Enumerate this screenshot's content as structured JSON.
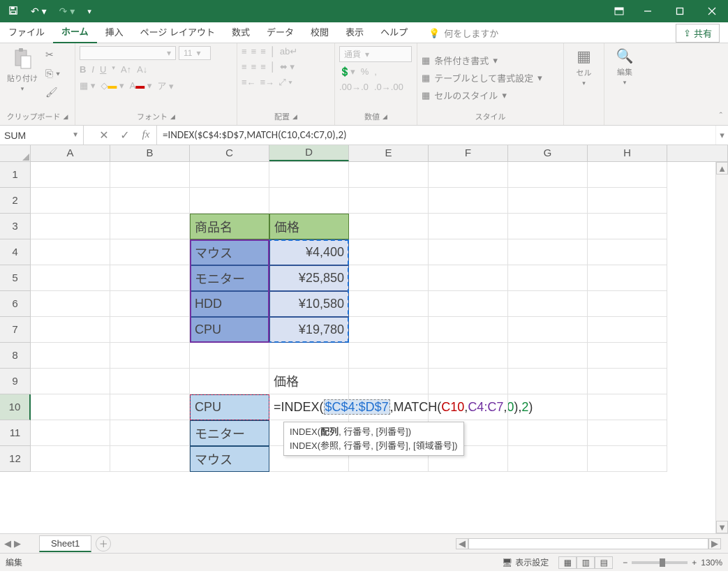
{
  "titlebar": {
    "qat": [
      "save",
      "undo",
      "redo"
    ]
  },
  "tabs": {
    "file": "ファイル",
    "home": "ホーム",
    "insert": "挿入",
    "pagelayout": "ページ レイアウト",
    "formulas": "数式",
    "data": "データ",
    "review": "校閲",
    "view": "表示",
    "help": "ヘルプ"
  },
  "tellme_placeholder": "何をしますか",
  "share": "共有",
  "ribbon": {
    "clipboard": {
      "paste": "貼り付け",
      "label": "クリップボード"
    },
    "font": {
      "label": "フォント",
      "size": "11"
    },
    "align": {
      "label": "配置"
    },
    "number": {
      "format": "通貨",
      "label": "数値"
    },
    "styles": {
      "cond": "条件付き書式",
      "table": "テーブルとして書式設定",
      "cell": "セルのスタイル",
      "label": "スタイル"
    },
    "cells": {
      "label": "セル"
    },
    "editing": {
      "label": "編集"
    }
  },
  "namebox": "SUM",
  "formula": "=INDEX($C$4:$D$7,MATCH(C10,C4:C7,0),2)",
  "columns": [
    "A",
    "B",
    "C",
    "D",
    "E",
    "F",
    "G",
    "H"
  ],
  "rows": [
    "1",
    "2",
    "3",
    "4",
    "5",
    "6",
    "7",
    "8",
    "9",
    "10",
    "11",
    "12"
  ],
  "headers": {
    "product": "商品名",
    "price": "価格"
  },
  "table": [
    {
      "name": "マウス",
      "price": "¥4,400"
    },
    {
      "name": "モニター",
      "price": "¥25,850"
    },
    {
      "name": "HDD",
      "price": "¥10,580"
    },
    {
      "name": "CPU",
      "price": "¥19,780"
    }
  ],
  "d9": "価格",
  "lookup": [
    "CPU",
    "モニター",
    "マウス"
  ],
  "incell": {
    "pre": "=INDEX(",
    "rng1": "$C$4:$D$7",
    "mid1": ",MATCH(",
    "c10": "C10",
    "comma": ",",
    "rng2": "C4:C7",
    "comma2": ",",
    "z": "0",
    "close1": "),",
    "two": "2",
    "end": ")"
  },
  "tip": {
    "l1a": "INDEX(",
    "l1b": "配列",
    "l1c": ", 行番号, [列番号])",
    "l2": "INDEX(参照, 行番号, [列番号], [領域番号])"
  },
  "sheet": "Sheet1",
  "status": {
    "mode": "編集",
    "display": "表示設定",
    "zoom": "130%"
  }
}
